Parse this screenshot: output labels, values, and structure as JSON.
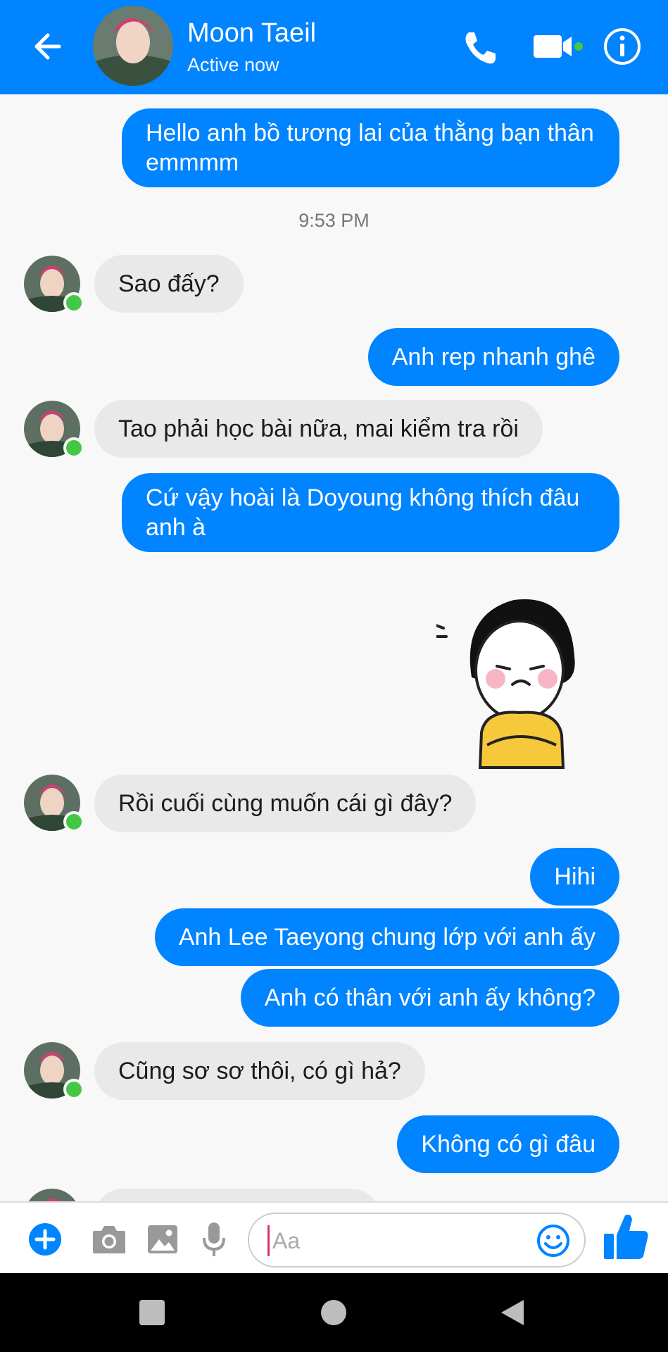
{
  "header": {
    "contact_name": "Moon Taeil",
    "status": "Active now"
  },
  "messages": {
    "m1": "Hello anh bồ tương lai của thằng bạn thân emmmm",
    "timestamp": "9:53 PM",
    "m2": "Sao đấy?",
    "m3": "Anh rep nhanh ghê",
    "m4": "Tao phải học bài nữa, mai kiểm tra rồi",
    "m5": "Cứ vậy hoài là Doyoung không thích đâu anh à",
    "m6": "Rồi cuối cùng muốn cái gì đây?",
    "m7": "Hihi",
    "m8": "Anh Lee Taeyong chung lớp với anh ấy",
    "m9": "Anh có thân với anh ấy không?",
    "m10": "Cũng sơ sơ thôi, có gì hả?",
    "m11": "Không có gì đâu"
  },
  "composer": {
    "placeholder": "Aa"
  },
  "colors": {
    "accent": "#0084ff",
    "incoming_bubble": "#e9e9e9",
    "online": "#44c744"
  },
  "icons": {
    "back": "arrow-left-icon",
    "call": "phone-icon",
    "video": "video-camera-icon",
    "info": "info-icon",
    "add": "plus-circle-icon",
    "camera": "camera-icon",
    "gallery": "image-icon",
    "mic": "microphone-icon",
    "emoji": "smile-icon",
    "like": "thumbs-up-icon"
  }
}
